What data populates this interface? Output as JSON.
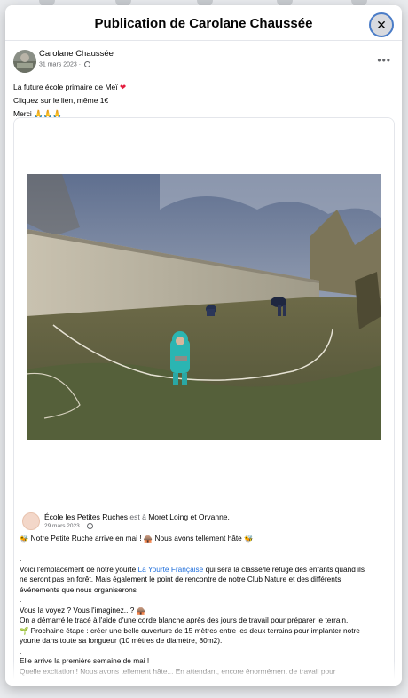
{
  "modal": {
    "title": "Publication de Carolane Chaussée",
    "close_icon": "close-icon"
  },
  "post": {
    "author": "Carolane Chaussée",
    "date": "31 mars 2023",
    "privacy_icon": "globe-icon",
    "more_icon": "more-options-icon",
    "lines": [
      {
        "text": "La future école primaire de Meï",
        "emoji": "❤",
        "emoji_icon": "heart-icon"
      },
      {
        "text": "Cliquez sur le lien, même 1€",
        "emoji": "",
        "emoji_icon": ""
      },
      {
        "text": "Merci",
        "emoji": "🙏🙏🙏",
        "emoji_icon": "praying-hands-icon"
      }
    ]
  },
  "shared": {
    "page_name": "École les Petites Ruches",
    "location_connector": "est à",
    "location": "Moret Loing et Orvanne.",
    "date": "29 mars 2023",
    "privacy_icon": "globe-icon",
    "lines": [
      "🐝 Notre Petite Ruche arrive en mai ! 🛖 Nous avons tellement hâte 🐝",
      ".",
      ".",
      "Voici l'emplacement de notre yourte |La Yourte Française| qui sera la classe/le refuge des enfants quand ils",
      "ne seront pas en forêt. Mais également le point de rencontre de notre Club Nature et des différents",
      "événements que nous organiserons",
      ".",
      "Vous la voyez ? Vous l'imaginez...? 🛖",
      "On a démarré le tracé à l'aide d'une corde blanche après des jours de travail pour préparer le terrain.",
      "🌱 Prochaine étape : créer une belle ouverture de 15 mètres entre les deux terrains pour implanter notre",
      "yourte dans toute sa longueur (10 mètres de diamètre, 80m2).",
      ".",
      "Elle arrive la première semaine de mai !",
      "Quelle excitation ! Nous avons tellement hâte... En attendant, encore énormément de travail pour"
    ]
  }
}
